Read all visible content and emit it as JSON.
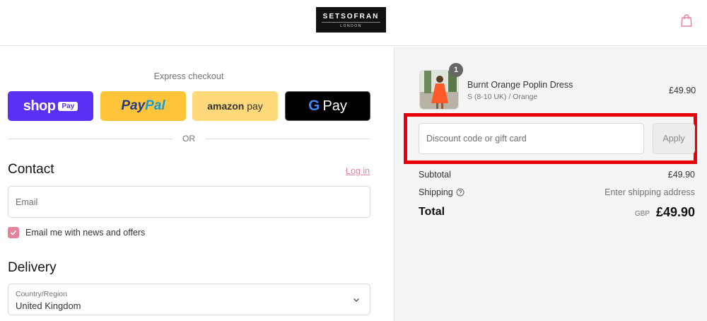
{
  "header": {
    "logo_brand": "SETSOFRAN",
    "logo_sub": "LONDON",
    "cart_icon": "shopping-bag-icon"
  },
  "express": {
    "title": "Express checkout",
    "shop_word": "shop",
    "shop_pay": "Pay",
    "paypal_a": "Pay",
    "paypal_b": "Pal",
    "amazon_a": "amazon",
    "amazon_b": " pay",
    "gpay_g": "G",
    "gpay_pay": "Pay",
    "or_text": "OR"
  },
  "contact": {
    "heading": "Contact",
    "login": "Log in",
    "email_placeholder": "Email",
    "newsletter_label": "Email me with news and offers",
    "newsletter_checked": true
  },
  "delivery": {
    "heading": "Delivery",
    "country_label": "Country/Region",
    "country_value": "United Kingdom"
  },
  "order": {
    "item_quantity": "1",
    "item_name": "Burnt Orange Poplin Dress",
    "item_variant": "S (8-10 UK) / Orange",
    "item_price": "£49.90",
    "discount_placeholder": "Discount code or gift card",
    "apply_label": "Apply",
    "subtotal_label": "Subtotal",
    "subtotal_value": "£49.90",
    "shipping_label": "Shipping",
    "shipping_value": "Enter shipping address",
    "total_label": "Total",
    "currency": "GBP",
    "total_value": "£49.90"
  },
  "colors": {
    "accent": "#e3849c",
    "shop_pay": "#5a31f4",
    "paypal": "#ffc439",
    "amazon_pay": "#ffd97a",
    "highlight": "#e8000b"
  }
}
